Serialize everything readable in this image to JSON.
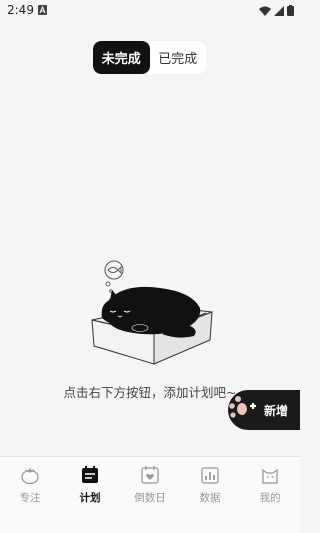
{
  "status_bar": {
    "time": "2:49",
    "icons": [
      "app-notification-icon",
      "wifi-icon",
      "signal-icon",
      "battery-icon"
    ]
  },
  "tabs": {
    "incomplete": "未完成",
    "completed": "已完成",
    "active": "incomplete"
  },
  "empty_state": {
    "message": "点击右下方按钮，添加计划吧~"
  },
  "add_button": {
    "label": "新增",
    "icon": "cat-paw-plus-icon"
  },
  "bottom_nav": {
    "active": "plan",
    "items": [
      {
        "key": "focus",
        "label": "专注",
        "icon": "tomato-icon"
      },
      {
        "key": "plan",
        "label": "计划",
        "icon": "calendar-list-icon"
      },
      {
        "key": "countdown",
        "label": "倒数日",
        "icon": "calendar-heart-icon"
      },
      {
        "key": "data",
        "label": "数据",
        "icon": "bar-chart-icon"
      },
      {
        "key": "mine",
        "label": "我的",
        "icon": "cat-face-icon"
      }
    ]
  },
  "colors": {
    "background": "#f5f5f5",
    "accent": "#111111",
    "inactive_text": "#999999"
  }
}
